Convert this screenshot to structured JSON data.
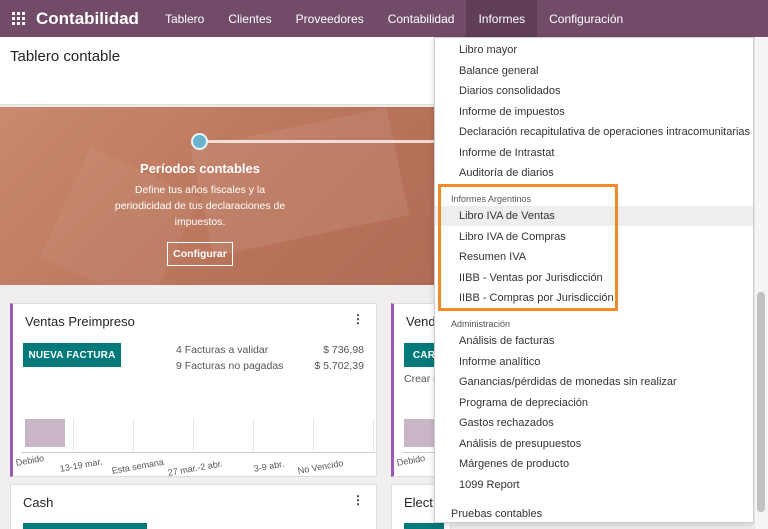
{
  "app": {
    "name": "Contabilidad"
  },
  "nav": {
    "items": [
      "Tablero",
      "Clientes",
      "Proveedores",
      "Contabilidad",
      "Informes",
      "Configuración"
    ],
    "active": "Informes"
  },
  "page": {
    "title": "Tablero contable"
  },
  "banner": {
    "step_title": "Períodos contables",
    "step_desc": "Define tus años fiscales y la periodicidad de tus declaraciones de impuestos.",
    "button": "Configurar"
  },
  "cards": {
    "ventas": {
      "title": "Ventas Preimpreso",
      "button": "NUEVA FACTURA",
      "stats": [
        {
          "label": "4 Facturas a validar",
          "value": "$ 736,98"
        },
        {
          "label": "9 Facturas no pagadas",
          "value": "$ 5.702,39"
        }
      ],
      "chart_ticks": [
        "Debido",
        "13-19 mar.",
        "Esta semana",
        "27 mar.-2 abr.",
        "3-9 abr.",
        "No Vencido"
      ]
    },
    "vend": {
      "title": "Vend",
      "button": "CAR",
      "text": "Crear r",
      "tick": "Debido"
    },
    "cash": {
      "title": "Cash"
    },
    "elect": {
      "title": "Elect"
    }
  },
  "menu": {
    "group1": [
      "Libro mayor",
      "Balance general",
      "Diarios consolidados",
      "Informe de impuestos",
      "Declaración recapitulativa de operaciones intracomunitarias",
      "Informe de Intrastat",
      "Auditoría de diarios"
    ],
    "argentinos_header": "Informes Argentinos",
    "argentinos": [
      "Libro IVA de Ventas",
      "Libro IVA de Compras",
      "Resumen IVA",
      "IIBB - Ventas por Jurisdicción",
      "IIBB - Compras por Jurisdicción"
    ],
    "admin_header": "Administración",
    "admin": [
      "Análisis de facturas",
      "Informe analítico",
      "Ganancias/pérdidas de monedas sin realizar",
      "Programa de depreciación",
      "Gastos rechazados",
      "Análisis de presupuestos",
      "Márgenes de producto",
      "1099 Report"
    ],
    "footer": "Pruebas contables"
  },
  "colors": {
    "navbar": "#714b67",
    "primary": "#00797b",
    "highlight": "#f28a2c"
  }
}
